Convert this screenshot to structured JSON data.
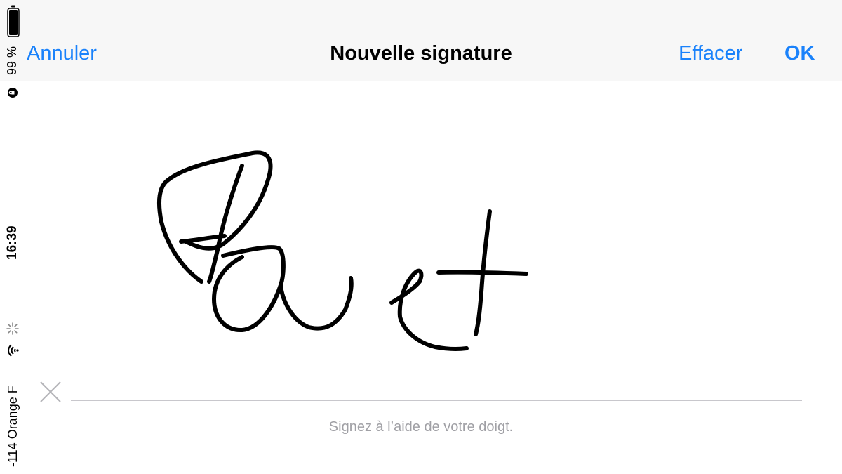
{
  "status_bar": {
    "carrier": "-114 Orange F",
    "time": "16:39",
    "battery_percent": "99 %",
    "wifi_icon": "wifi-icon",
    "activity_icon": "activity-spinner-icon",
    "lock_icon": "orientation-lock-icon",
    "battery_icon": "battery-icon"
  },
  "nav": {
    "cancel_label": "Annuler",
    "title": "Nouvelle signature",
    "clear_label": "Effacer",
    "ok_label": "OK",
    "accent_color": "#1a82fb"
  },
  "signature": {
    "hint": "Signez à l’aide de votre doigt.",
    "x_icon": "close-x-icon",
    "stroke_color": "#000000",
    "line_color": "#c8c7cc"
  }
}
